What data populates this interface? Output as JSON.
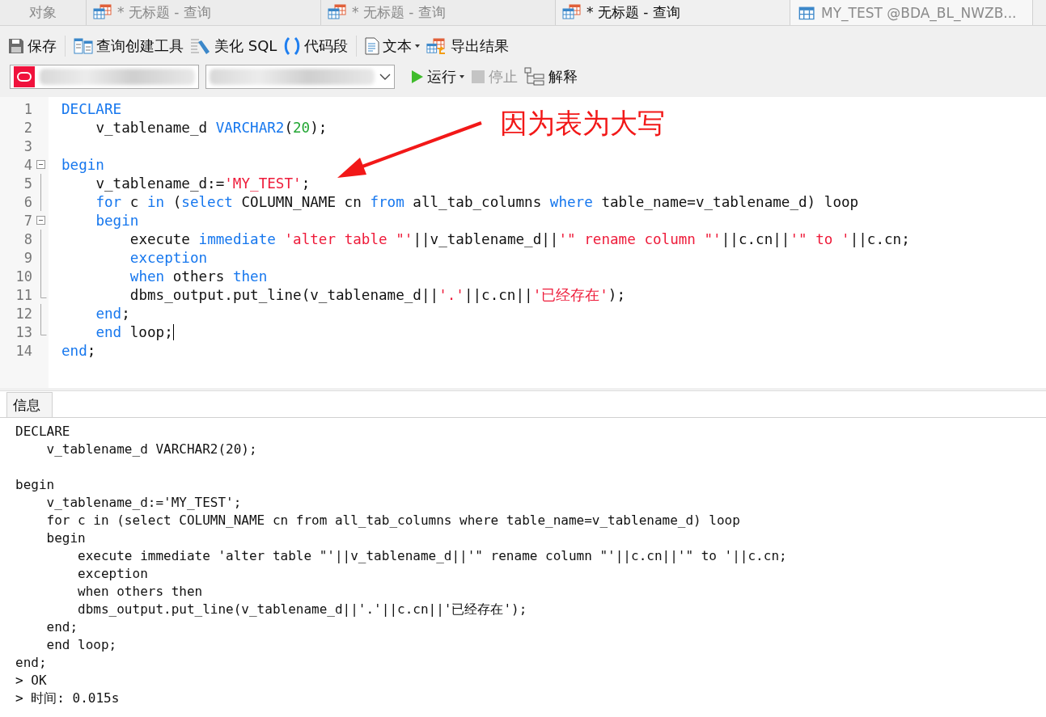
{
  "tabs": [
    {
      "label": "对象",
      "kind": "plain",
      "selected": false
    },
    {
      "label": "* 无标题 - 查询",
      "kind": "query",
      "selected": false
    },
    {
      "label": "* 无标题 - 查询",
      "kind": "query",
      "selected": false
    },
    {
      "label": "* 无标题 - 查询",
      "kind": "query",
      "selected": true
    },
    {
      "label": "MY_TEST @BDA_BL_NWZB...",
      "kind": "table",
      "selected": false
    }
  ],
  "toolbar": [
    {
      "label": "保存",
      "kind": "save",
      "dropdown": false
    },
    {
      "label": "查询创建工具",
      "kind": "builder",
      "dropdown": false
    },
    {
      "label": "美化 SQL",
      "kind": "beautify",
      "dropdown": false
    },
    {
      "label": "代码段",
      "kind": "snippet",
      "dropdown": false
    },
    {
      "label": "文本",
      "kind": "text",
      "dropdown": true
    },
    {
      "label": "导出结果",
      "kind": "export",
      "dropdown": false
    }
  ],
  "run_bar": [
    {
      "label": "运行",
      "kind": "run",
      "dropdown": true,
      "disabled": false
    },
    {
      "label": "停止",
      "kind": "stop",
      "dropdown": false,
      "disabled": true
    },
    {
      "label": "解释",
      "kind": "explain",
      "dropdown": false,
      "disabled": false
    }
  ],
  "editor": {
    "lines": [
      {
        "number": "1",
        "tokens": [
          {
            "kind": "keyword",
            "text": "DECLARE"
          }
        ],
        "children": [
          {
            "number": "2",
            "tokens": [
              {
                "kind": "plain",
                "text": "v_tablename_d "
              },
              {
                "kind": "keyword",
                "text": "VARCHAR2"
              },
              {
                "kind": "plain",
                "text": "("
              },
              {
                "kind": "number",
                "text": "20"
              },
              {
                "kind": "plain",
                "text": ");"
              }
            ]
          }
        ]
      },
      {
        "number": "3"
      },
      {
        "number": "4",
        "expanded": true,
        "tokens": [
          {
            "kind": "keyword",
            "text": "begin"
          }
        ],
        "children": [
          {
            "number": "5",
            "tokens": [
              {
                "kind": "plain",
                "text": "v_tablename_d:="
              },
              {
                "kind": "string",
                "text": "'MY_TEST'"
              },
              {
                "kind": "plain",
                "text": ";"
              }
            ]
          },
          {
            "number": "6",
            "tokens": [
              {
                "kind": "keyword",
                "text": "for"
              },
              {
                "kind": "plain",
                "text": " c "
              },
              {
                "kind": "keyword",
                "text": "in"
              },
              {
                "kind": "plain",
                "text": " ("
              },
              {
                "kind": "keyword",
                "text": "select"
              },
              {
                "kind": "plain",
                "text": " COLUMN_NAME cn "
              },
              {
                "kind": "keyword",
                "text": "from"
              },
              {
                "kind": "plain",
                "text": " all_tab_columns "
              },
              {
                "kind": "keyword",
                "text": "where"
              },
              {
                "kind": "plain",
                "text": " table_name=v_tablename_d) loop"
              }
            ]
          },
          {
            "number": "7",
            "expanded": true,
            "tokens": [
              {
                "kind": "keyword",
                "text": "begin"
              }
            ],
            "children": [
              {
                "number": "8",
                "tokens": [
                  {
                    "kind": "plain",
                    "text": "execute "
                  },
                  {
                    "kind": "keyword",
                    "text": "immediate "
                  },
                  {
                    "kind": "string",
                    "text": "'alter table \"'"
                  },
                  {
                    "kind": "plain",
                    "text": "||v_tablename_d||"
                  },
                  {
                    "kind": "string",
                    "text": "'\" rename column \"'"
                  },
                  {
                    "kind": "plain",
                    "text": "||c.cn||"
                  },
                  {
                    "kind": "string",
                    "text": "'\" to '"
                  },
                  {
                    "kind": "plain",
                    "text": "||c.cn;"
                  }
                ]
              },
              {
                "number": "9",
                "tokens": [
                  {
                    "kind": "keyword",
                    "text": "exception"
                  }
                ]
              },
              {
                "number": "10",
                "tokens": [
                  {
                    "kind": "keyword",
                    "text": "when"
                  },
                  {
                    "kind": "plain",
                    "text": " others "
                  },
                  {
                    "kind": "keyword",
                    "text": "then"
                  }
                ]
              },
              {
                "number": "11",
                "tokens": [
                  {
                    "kind": "plain",
                    "text": "dbms_output.put_line(v_tablename_d||"
                  },
                  {
                    "kind": "string",
                    "text": "'.'"
                  },
                  {
                    "kind": "plain",
                    "text": "||c.cn||"
                  },
                  {
                    "kind": "string",
                    "text": "'已经存在'"
                  },
                  {
                    "kind": "plain",
                    "text": ");"
                  }
                ]
              }
            ]
          },
          {
            "number": "12",
            "tokens": [
              {
                "kind": "keyword",
                "text": "end"
              },
              {
                "kind": "plain",
                "text": ";"
              }
            ]
          },
          {
            "number": "13",
            "cursor": true,
            "tokens": [
              {
                "kind": "keyword",
                "text": "end"
              },
              {
                "kind": "plain",
                "text": " loop;"
              }
            ]
          }
        ]
      },
      {
        "number": "14",
        "tokens": [
          {
            "kind": "keyword",
            "text": "end"
          },
          {
            "kind": "plain",
            "text": ";"
          }
        ]
      }
    ]
  },
  "annotation": {
    "text": "因为表为大写"
  },
  "output": {
    "tab": {
      "label": "信息",
      "selected": true
    },
    "lines": [
      {
        "text": "DECLARE"
      },
      {
        "text": "    v_tablename_d VARCHAR2(20);"
      },
      {
        "text": "begin",
        "blank_before": true
      },
      {
        "text": "    v_tablename_d:='MY_TEST';"
      },
      {
        "text": "    for c in (select COLUMN_NAME cn from all_tab_columns where table_name=v_tablename_d) loop"
      },
      {
        "text": "    begin"
      },
      {
        "text": "        execute immediate 'alter table \"'||v_tablename_d||'\" rename column \"'||c.cn||'\" to '||c.cn;"
      },
      {
        "text": "        exception"
      },
      {
        "text": "        when others then"
      },
      {
        "text": "        dbms_output.put_line(v_tablename_d||'.'||c.cn||'已经存在');"
      },
      {
        "text": "    end;"
      },
      {
        "text": "    end loop;"
      },
      {
        "text": "end;"
      },
      {
        "text": "> OK"
      },
      {
        "text": "> 时间: 0.015s"
      }
    ]
  }
}
